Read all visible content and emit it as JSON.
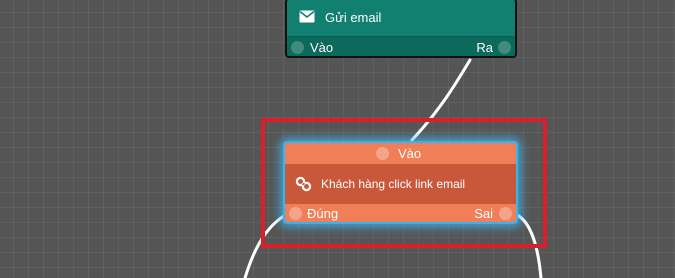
{
  "canvas": {
    "background": "#555555",
    "connector_color": "#ffffff"
  },
  "email_node": {
    "icon": "envelope-icon",
    "label": "Gửi email",
    "input_label": "Vào",
    "output_label": "Ra",
    "color": "#128070"
  },
  "condition_node": {
    "selected": true,
    "input_label": "Vào",
    "icon": "link-icon",
    "label": "Khách hàng click link email",
    "true_label": "Đúng",
    "false_label": "Sai",
    "color": "#e2673f",
    "highlight_color": "#35b4f0"
  },
  "selection": {
    "color": "#d81f2a"
  }
}
